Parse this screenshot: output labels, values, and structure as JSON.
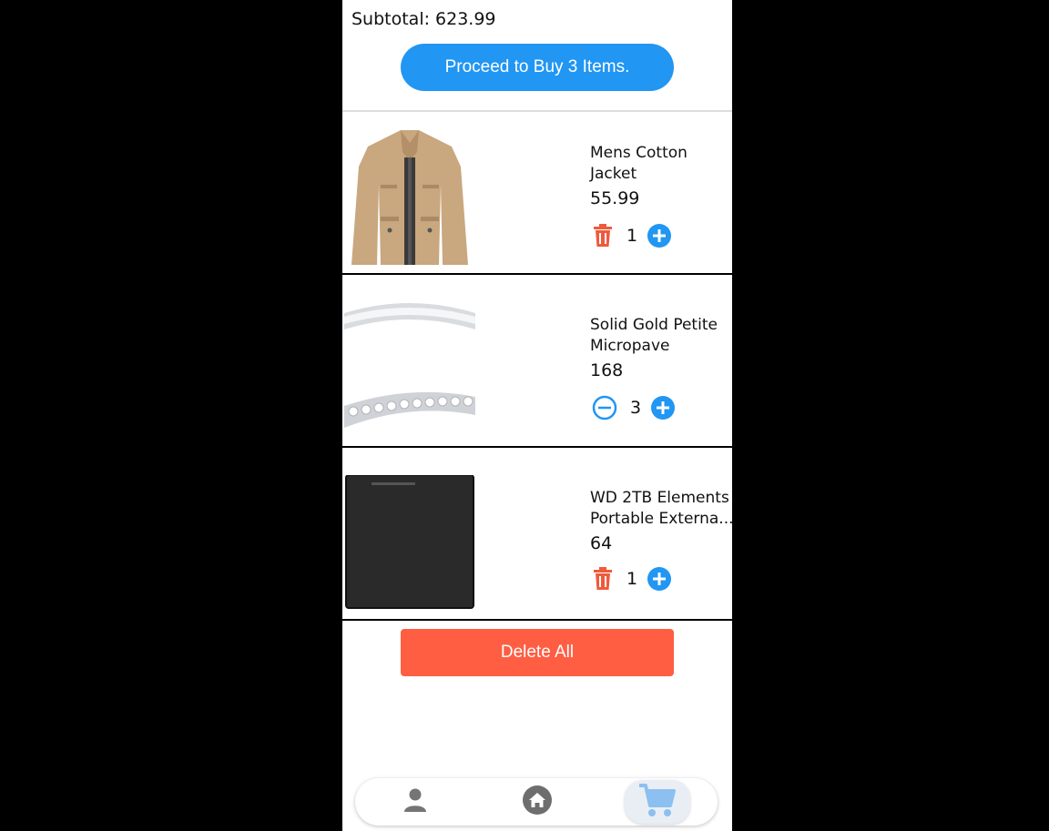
{
  "cart": {
    "subtotal_label": "Subtotal:",
    "subtotal_value": "623.99",
    "buy_button_label": "Proceed to Buy 3 Items.",
    "delete_all_label": "Delete All"
  },
  "items": [
    {
      "name": "Mens Cotton Jacket",
      "price": "55.99",
      "quantity": "1",
      "left_control": "trash-icon"
    },
    {
      "name": "Solid Gold Petite Micropave",
      "price": "168",
      "quantity": "3",
      "left_control": "minus-circle-icon"
    },
    {
      "name": "WD 2TB Elements Portable Externa...",
      "price": "64",
      "quantity": "1",
      "left_control": "trash-icon"
    }
  ],
  "nav": {
    "items": [
      "profile-icon",
      "home-icon",
      "cart-icon"
    ],
    "active": "cart-icon"
  },
  "colors": {
    "primary_blue": "#2196f3",
    "delete_red": "#ff5e43",
    "trash_red": "#f05a3c",
    "cart_active": "#8cc0f0"
  }
}
